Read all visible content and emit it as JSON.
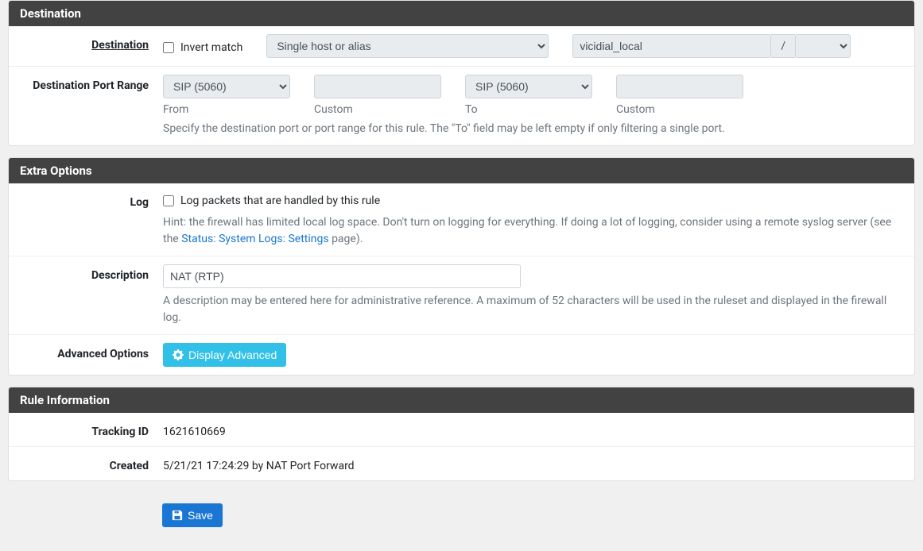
{
  "destination": {
    "header": "Destination",
    "label": "Destination",
    "invert_label": "Invert match",
    "type_value": "Single host or alias",
    "alias_value": "vicidial_local",
    "slash": "/",
    "mask_value": "",
    "port_range_label": "Destination Port Range",
    "from_value": "SIP (5060)",
    "from_sub": "From",
    "custom1_value": "",
    "custom1_sub": "Custom",
    "to_value": "SIP (5060)",
    "to_sub": "To",
    "custom2_value": "",
    "custom2_sub": "Custom",
    "port_help": "Specify the destination port or port range for this rule. The \"To\" field may be left empty if only filtering a single port."
  },
  "extra": {
    "header": "Extra Options",
    "log_label": "Log",
    "log_checkbox_label": "Log packets that are handled by this rule",
    "log_hint_prefix": "Hint: the firewall has limited local log space. Don't turn on logging for everything. If doing a lot of logging, consider using a remote syslog server (see the ",
    "log_hint_link": "Status: System Logs: Settings",
    "log_hint_suffix": " page).",
    "description_label": "Description",
    "description_value": "NAT (RTP)",
    "description_help": "A description may be entered here for administrative reference. A maximum of 52 characters will be used in the ruleset and displayed in the firewall log.",
    "advanced_label": "Advanced Options",
    "advanced_button": "Display Advanced"
  },
  "rule_info": {
    "header": "Rule Information",
    "tracking_label": "Tracking ID",
    "tracking_value": "1621610669",
    "created_label": "Created",
    "created_value": "5/21/21 17:24:29 by NAT Port Forward"
  },
  "save_button": "Save"
}
